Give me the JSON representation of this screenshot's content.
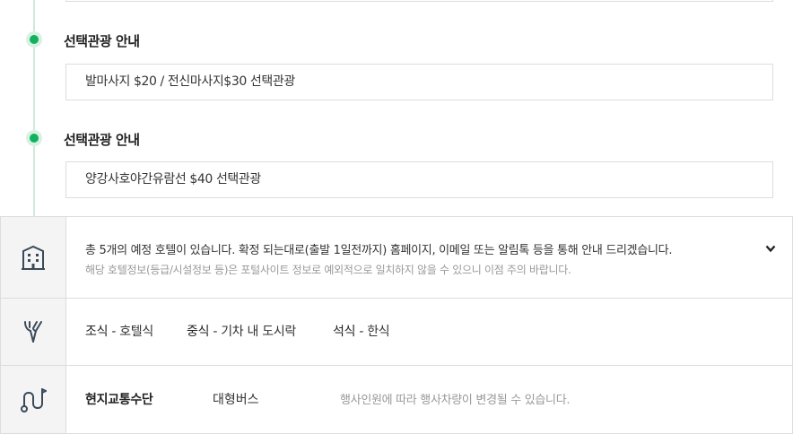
{
  "timeline": {
    "items": [
      {
        "title": "선택관광 안내",
        "content": "발마사지 $20 / 전신마사지$30 선택관광"
      },
      {
        "title": "선택관광 안내",
        "content": "양강사호야간유람선 $40 선택관광"
      }
    ]
  },
  "hotel": {
    "icon": "building-icon",
    "main_text": "총 5개의 예정 호텔이 있습니다. 확정 되는대로(출발 1일전까지) 홈페이지, 이메일 또는 알림톡 등을 통해 안내 드리겠습니다.",
    "sub_text": "해당 호텔정보(등급/시설정보 등)은 포털사이트 정보로 예외적으로 일치하지 않을 수 있으니 이점 주의 바랍니다."
  },
  "meals": {
    "icon": "utensils-icon",
    "breakfast_label": "조식",
    "breakfast_value": "- 호텔식",
    "lunch_label": "중식",
    "lunch_value": "- 기차 내 도시락",
    "dinner_label": "석식",
    "dinner_value": "- 한식"
  },
  "transport": {
    "icon": "route-icon",
    "label": "현지교통수단",
    "value": "대형버스",
    "note": "행사인원에 따라 행사차량이 변경될 수 있습니다."
  },
  "colors": {
    "accent_green": "#12b15e",
    "timeline_line": "#cfe9dd"
  }
}
